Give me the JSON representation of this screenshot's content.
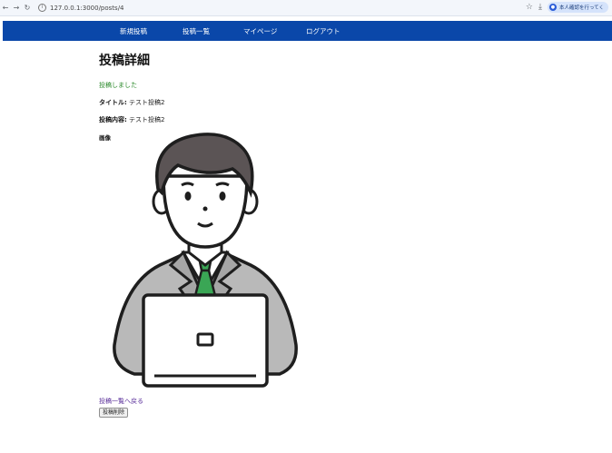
{
  "browser": {
    "url": "127.0.0.1:3000/posts/4",
    "profile_label": "本人確認を行ってく"
  },
  "nav": {
    "items": [
      "新規投稿",
      "投稿一覧",
      "マイページ",
      "ログアウト"
    ]
  },
  "page": {
    "title": "投稿詳細",
    "flash": "投稿しました",
    "title_label": "タイトル:",
    "title_value": "テスト投稿2",
    "content_label": "投稿内容:",
    "content_value": "テスト投稿2",
    "image_label": "画像",
    "back_link": "投稿一覧へ戻る",
    "delete_button": "投稿削除"
  },
  "colors": {
    "navbar": "#0a47a9",
    "flash": "#2b8a2b",
    "link": "#5a2f9a"
  },
  "icons": [
    "back-arrow-icon",
    "forward-arrow-icon",
    "reload-icon",
    "info-icon",
    "bookmark-star-icon",
    "download-icon",
    "profile-avatar-icon"
  ]
}
